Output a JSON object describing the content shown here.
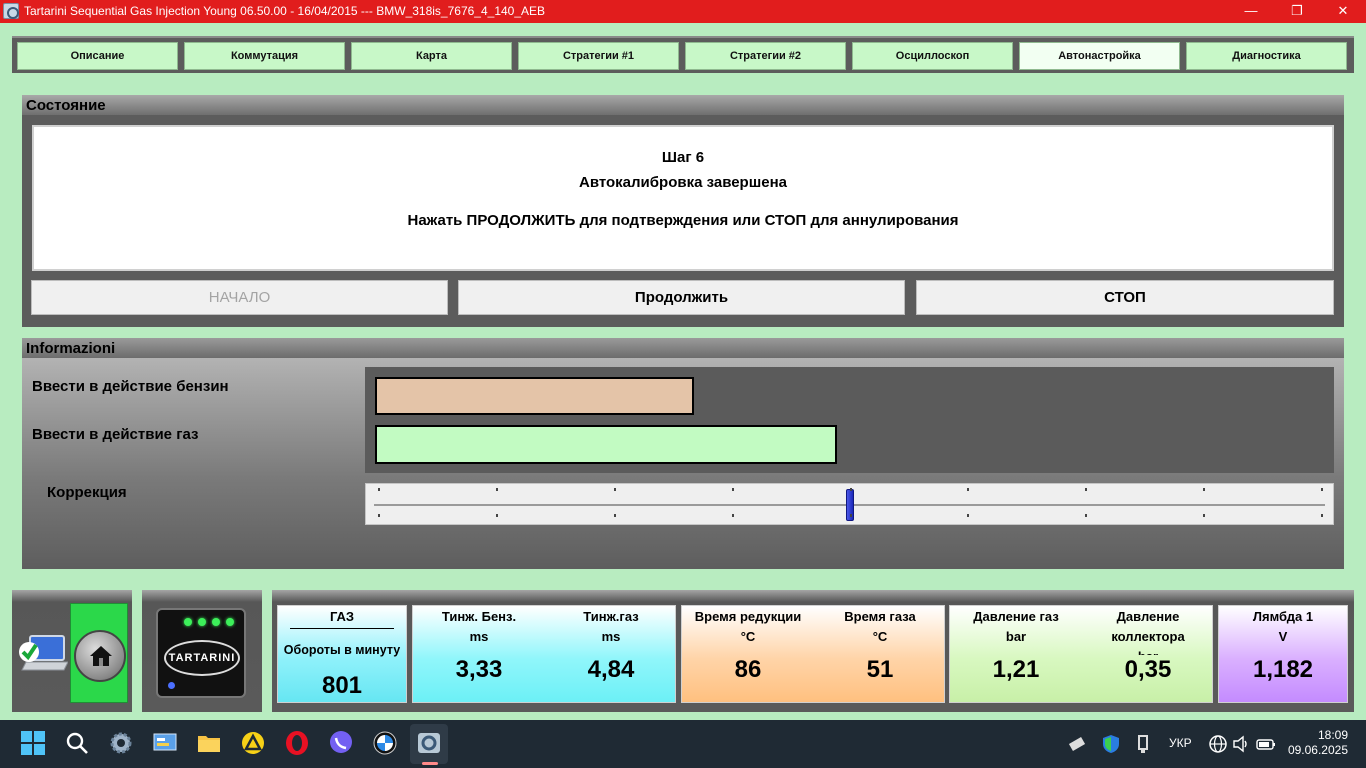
{
  "window": {
    "title": "Tartarini Sequential Gas Injection Young 06.50.00 - 16/04/2015 --- BMW_318is_7676_4_140_AEB",
    "minimize": "—",
    "restore": "❐",
    "close": "✕"
  },
  "tabs": [
    {
      "label": "Описание"
    },
    {
      "label": "Коммутация"
    },
    {
      "label": "Карта"
    },
    {
      "label": "Стратегии #1"
    },
    {
      "label": "Стратегии #2"
    },
    {
      "label": "Осциллоскоп"
    },
    {
      "label": "Автонастройка",
      "active": true
    },
    {
      "label": "Диагностика"
    }
  ],
  "state_panel": {
    "header": "Состояние",
    "step": "Шаг 6",
    "status": "Автокалибровка завершена",
    "instruction": "Нажать ПРОДОЛЖИТЬ для подтверждения или СТОП для аннулирования",
    "start_label": "НАЧАЛО",
    "continue_label": "Продолжить",
    "stop_label": "СТОП"
  },
  "info_panel": {
    "header": "Informazioni",
    "petrol_label": "Ввести в действие бензин",
    "gas_label": "Ввести в действие газ",
    "correction_label": "Коррекция",
    "petrol_level": 0.336,
    "gas_level": 0.487,
    "correction_position": 0.5,
    "colors": {
      "petrol": "#e4c4a8",
      "gas": "#c2fbc2",
      "slider_thumb": "#2a36d0"
    }
  },
  "gauges": {
    "gas": {
      "title": "ГАЗ",
      "label": "Обороты в минуту",
      "value": "801"
    },
    "inj_petrol": {
      "label": "Тинж. Бенз.",
      "unit": "ms",
      "value": "3,33"
    },
    "inj_gas": {
      "label": "Тинж.газ",
      "unit": "ms",
      "value": "4,84"
    },
    "reducer_temp": {
      "label": "Время редукции",
      "unit": "°C",
      "value": "86"
    },
    "gas_temp": {
      "label": "Время газа",
      "unit": "°C",
      "value": "51"
    },
    "gas_pressure": {
      "label": "Давление газ",
      "unit": "bar",
      "value": "1,21"
    },
    "manifold_pressure": {
      "label": "Давление",
      "label2": "коллектора",
      "unit": "bar",
      "value": "0,35"
    },
    "lambda": {
      "label": "Лямбда 1",
      "unit": "V",
      "value": "1,182"
    }
  },
  "device": {
    "brand": "TARTARINI"
  },
  "taskbar": {
    "language": "УКР",
    "time": "18:09",
    "date": "09.06.2025"
  }
}
